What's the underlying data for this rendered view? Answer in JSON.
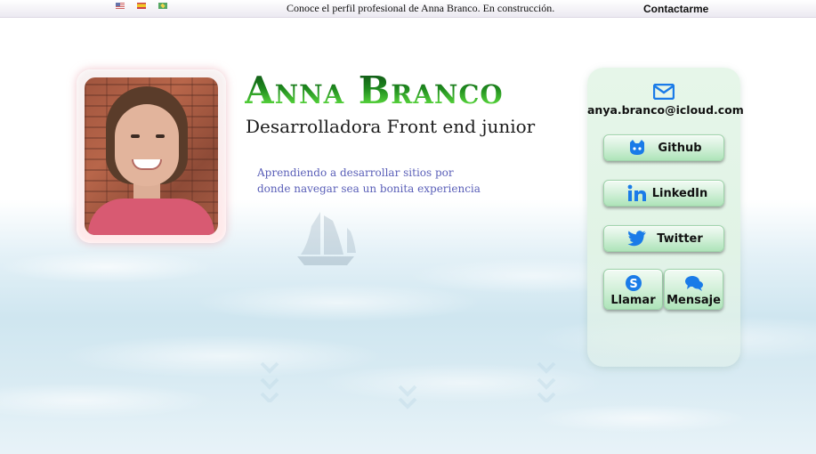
{
  "header": {
    "languages": [
      {
        "name": "english",
        "icon": "us-flag-icon"
      },
      {
        "name": "spanish",
        "icon": "spain-flag-icon"
      },
      {
        "name": "portuguese",
        "icon": "brazil-flag-icon"
      }
    ],
    "tagline": "Conoce el perfil profesional de Anna Branco. En construcción.",
    "contact_link": "Contactarme"
  },
  "profile": {
    "name": "Anna Branco",
    "role": "Desarrolladora Front end junior",
    "bio": "Aprendiendo a desarrollar sitios por donde navegar sea un bonita experiencia"
  },
  "contact_card": {
    "email_icon": "envelope-icon",
    "email": "anya.branco@icloud.com",
    "buttons": [
      {
        "label": "Github",
        "icon": "github-icon"
      },
      {
        "label": "LinkedIn",
        "icon": "linkedin-icon"
      },
      {
        "label": "Twitter",
        "icon": "twitter-icon"
      },
      {
        "label": "Llamar",
        "icon": "skype-icon"
      },
      {
        "label": "Mensaje",
        "icon": "chat-bubbles-icon"
      }
    ]
  },
  "colors": {
    "accent_blue": "#1a7be8",
    "name_green": "#1f8a1e",
    "bio_text": "#5a5fb8",
    "card_bg": "#e6f6e9"
  }
}
